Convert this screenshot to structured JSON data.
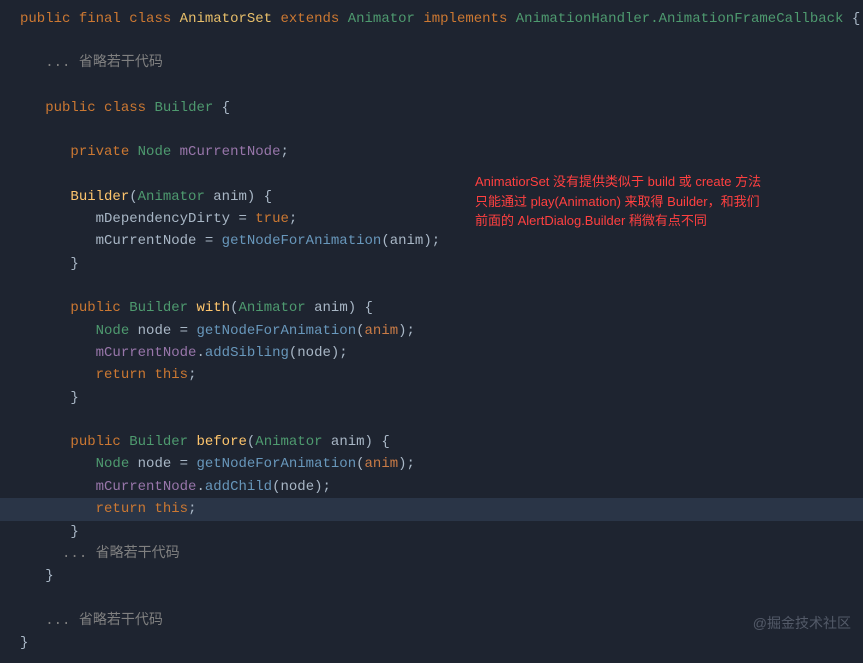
{
  "code": {
    "l1": {
      "public": "public",
      "final": "final",
      "class": "class",
      "name": "AnimatorSet",
      "extends": "extends",
      "super": "Animator",
      "implements": "implements",
      "iface": "AnimationHandler.AnimationFrameCallback",
      "brace": " {"
    },
    "omit1": "... 省略若干代码",
    "builder_decl": {
      "public": "public",
      "class": "class",
      "name": "Builder",
      "brace": " {"
    },
    "field_node": {
      "private": "private",
      "type": "Node",
      "name": "mCurrentNode",
      "semi": ";"
    },
    "ctor": {
      "name": "Builder",
      "lp": "(",
      "ptype": "Animator",
      "pname": "anim",
      "rp": ") {"
    },
    "ctor_b1": {
      "field": "mDependencyDirty",
      "eq": " = ",
      "val": "true",
      "semi": ";"
    },
    "ctor_b2": {
      "field": "mCurrentNode",
      "eq": " = ",
      "call": "getNodeForAnimation",
      "lp": "(",
      "arg": "anim",
      "rp": ");"
    },
    "close": "}",
    "with_decl": {
      "public": "public",
      "ret": "Builder",
      "name": "with",
      "lp": "(",
      "ptype": "Animator",
      "pname": "anim",
      "rp": ") {"
    },
    "with_b1": {
      "type": "Node",
      "var": "node",
      "eq": " = ",
      "call": "getNodeForAnimation",
      "lp": "(",
      "arg": "anim",
      "rp": ");"
    },
    "with_b2": {
      "field": "mCurrentNode",
      "dot": ".",
      "call": "addSibling",
      "lp": "(",
      "arg": "node",
      "rp": ");"
    },
    "ret_this": {
      "return": "return",
      "this": "this",
      "semi": ";"
    },
    "before_decl": {
      "public": "public",
      "ret": "Builder",
      "name": "before",
      "lp": "(",
      "ptype": "Animator",
      "pname": "anim",
      "rp": ") {"
    },
    "before_b1": {
      "type": "Node",
      "var": "node",
      "eq": " = ",
      "call": "getNodeForAnimation",
      "lp": "(",
      "arg": "anim",
      "rp": ");"
    },
    "before_b2": {
      "field": "mCurrentNode",
      "dot": ".",
      "call": "addChild",
      "lp": "(",
      "arg": "node",
      "rp": ");"
    },
    "omit2": "... 省略若干代码",
    "omit3": "... 省略若干代码"
  },
  "annotation": {
    "l1": "AnimatiorSet 没有提供类似于 build 或 create 方法",
    "l2": "只能通过 play(Animation) 来取得 Builder，和我们",
    "l3": "前面的 AlertDialog.Builder 稍微有点不同"
  },
  "watermark": "@掘金技术社区"
}
